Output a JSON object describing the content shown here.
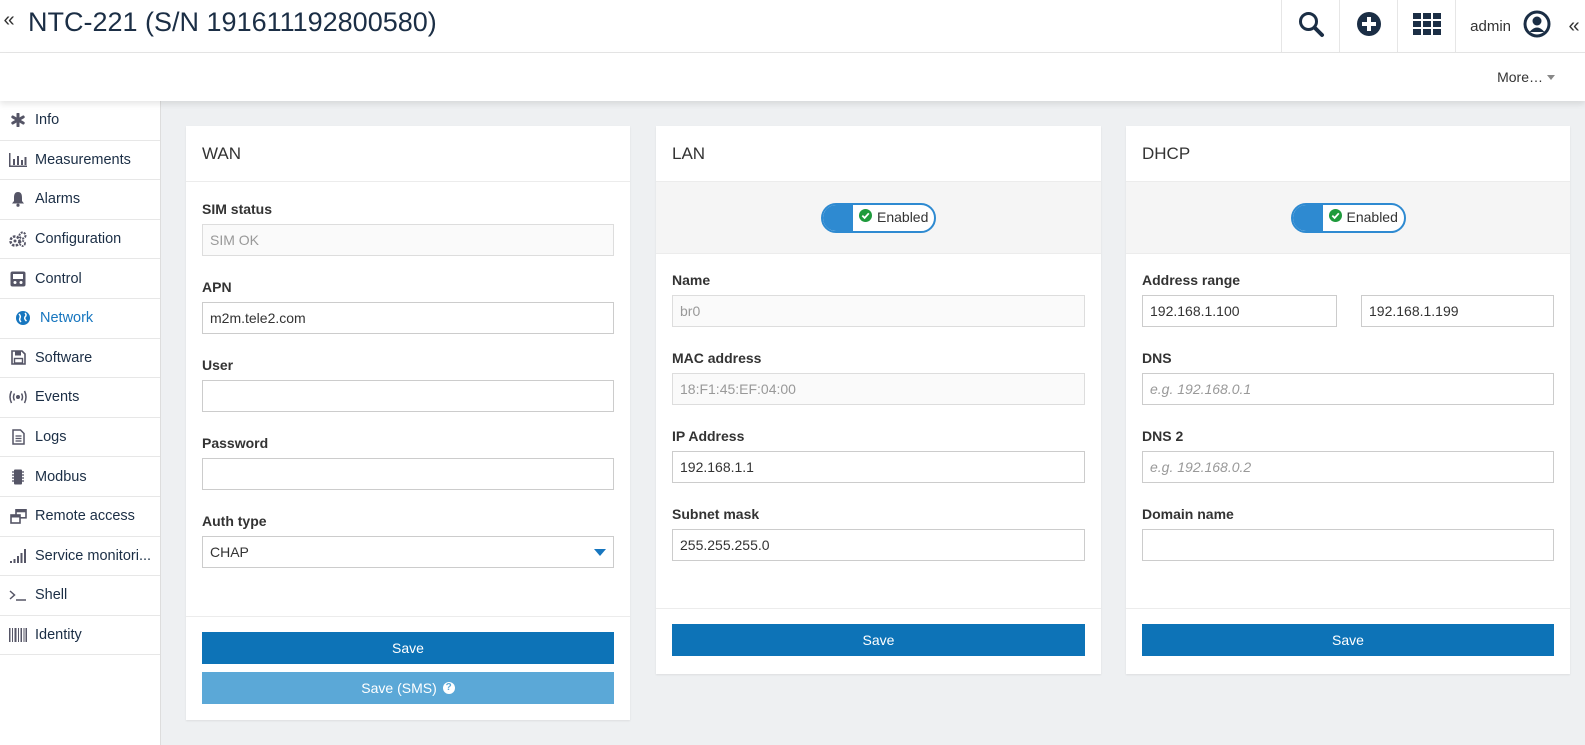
{
  "header": {
    "collapse_left": "«",
    "title": "NTC-221 (S/N 191611192800580)",
    "user": "admin",
    "collapse_right": "«",
    "more_label": "More…"
  },
  "sidebar": {
    "items": [
      {
        "label": "Info",
        "icon": "asterisk-icon"
      },
      {
        "label": "Measurements",
        "icon": "bar-chart-icon"
      },
      {
        "label": "Alarms",
        "icon": "bell-icon"
      },
      {
        "label": "Configuration",
        "icon": "gears-icon"
      },
      {
        "label": "Control",
        "icon": "control-panel-icon"
      },
      {
        "label": "Network",
        "icon": "globe-icon"
      },
      {
        "label": "Software",
        "icon": "floppy-icon"
      },
      {
        "label": "Events",
        "icon": "broadcast-icon"
      },
      {
        "label": "Logs",
        "icon": "document-icon"
      },
      {
        "label": "Modbus",
        "icon": "chip-icon"
      },
      {
        "label": "Remote access",
        "icon": "windows-icon"
      },
      {
        "label": "Service monitori...",
        "icon": "signal-icon"
      },
      {
        "label": "Shell",
        "icon": "terminal-icon"
      },
      {
        "label": "Identity",
        "icon": "barcode-icon"
      }
    ],
    "active": "Network"
  },
  "wan": {
    "title": "WAN",
    "sim_status_label": "SIM status",
    "sim_status_value": "SIM OK",
    "apn_label": "APN",
    "apn_value": "m2m.tele2.com",
    "user_label": "User",
    "user_value": "",
    "password_label": "Password",
    "password_value": "",
    "auth_label": "Auth type",
    "auth_value": "CHAP",
    "save_label": "Save",
    "save_sms_label": "Save (SMS)",
    "help_glyph": "?"
  },
  "lan": {
    "title": "LAN",
    "toggle_label": "Enabled",
    "name_label": "Name",
    "name_value": "br0",
    "mac_label": "MAC address",
    "mac_value": "18:F1:45:EF:04:00",
    "ip_label": "IP Address",
    "ip_value": "192.168.1.1",
    "mask_label": "Subnet mask",
    "mask_value": "255.255.255.0",
    "save_label": "Save"
  },
  "dhcp": {
    "title": "DHCP",
    "toggle_label": "Enabled",
    "range_label": "Address range",
    "range_start": "192.168.1.100",
    "range_end": "192.168.1.199",
    "dns_label": "DNS",
    "dns_placeholder": "e.g. 192.168.0.1",
    "dns2_label": "DNS 2",
    "dns2_placeholder": "e.g. 192.168.0.2",
    "domain_label": "Domain name",
    "domain_value": "",
    "save_label": "Save"
  },
  "colors": {
    "accent": "#0d73b7",
    "toggle": "#2e8ad1",
    "check": "#1e9a3c",
    "title": "#1b2e45"
  }
}
